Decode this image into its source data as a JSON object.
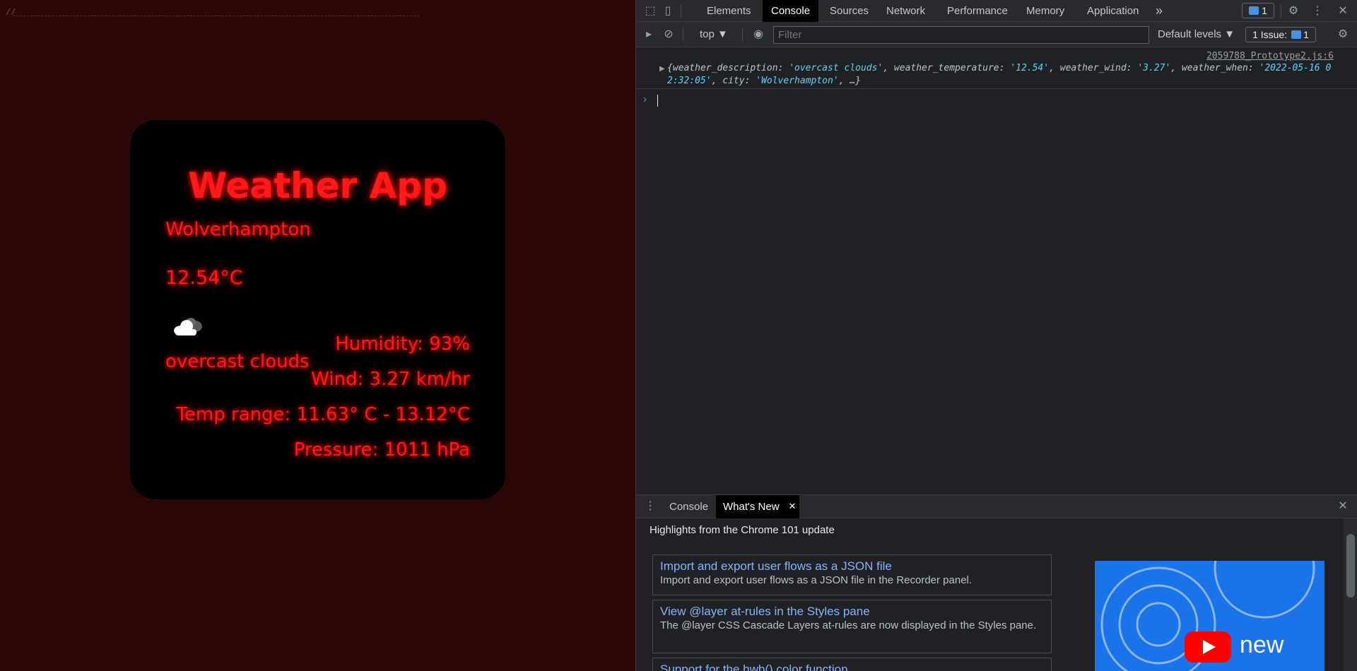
{
  "page": {
    "top_line": "//",
    "card": {
      "title": "Weather App",
      "city": "Wolverhampton",
      "temperature": "12.54°C",
      "weather_icon": "overcast-cloud-icon",
      "description": "overcast clouds",
      "humidity": "Humidity: 93%",
      "wind": "Wind: 3.27 km/hr",
      "temp_range": "Temp range: 11.63° C - 13.12°C",
      "pressure": "Pressure: 1011 hPa",
      "glow_color": "#ff1a1a",
      "background": "#2b0708"
    }
  },
  "devtools": {
    "tabs": [
      "Elements",
      "Console",
      "Sources",
      "Network",
      "Performance",
      "Memory",
      "Application"
    ],
    "active_tab": "Console",
    "more_tabs": "»",
    "messages_badge": "1",
    "toolbar": {
      "context": "top ▼",
      "filter_placeholder": "Filter",
      "levels": "Default levels ▼",
      "issues_label": "1 Issue:",
      "issues_count": "1"
    },
    "console": {
      "source": "2059788_Prototype2.js:6",
      "log": {
        "open": "{",
        "entries": [
          {
            "key": "weather_description",
            "value": "'overcast clouds'"
          },
          {
            "key": "weather_temperature",
            "value": "'12.54'"
          },
          {
            "key": "weather_wind",
            "value": "'3.27'"
          },
          {
            "key": "weather_when",
            "value": "'2022-05-16 02:32:05'"
          },
          {
            "key": "city",
            "value": "'Wolverhampton'"
          }
        ],
        "ellipsis": "…}"
      },
      "prompt": "›"
    },
    "drawer": {
      "tabs": [
        "Console",
        "What's New"
      ],
      "active_tab": "What's New",
      "title": "Highlights from the Chrome 101 update",
      "items": [
        {
          "title": "Import and export user flows as a JSON file",
          "desc": "Import and export user flows as a JSON file in the Recorder panel."
        },
        {
          "title": "View @layer at-rules in the Styles pane",
          "desc": "The @layer CSS Cascade Layers at-rules are now displayed in the Styles pane."
        },
        {
          "title": "Support for the hwb() color function",
          "desc": ""
        }
      ],
      "promo_word": "new"
    }
  }
}
